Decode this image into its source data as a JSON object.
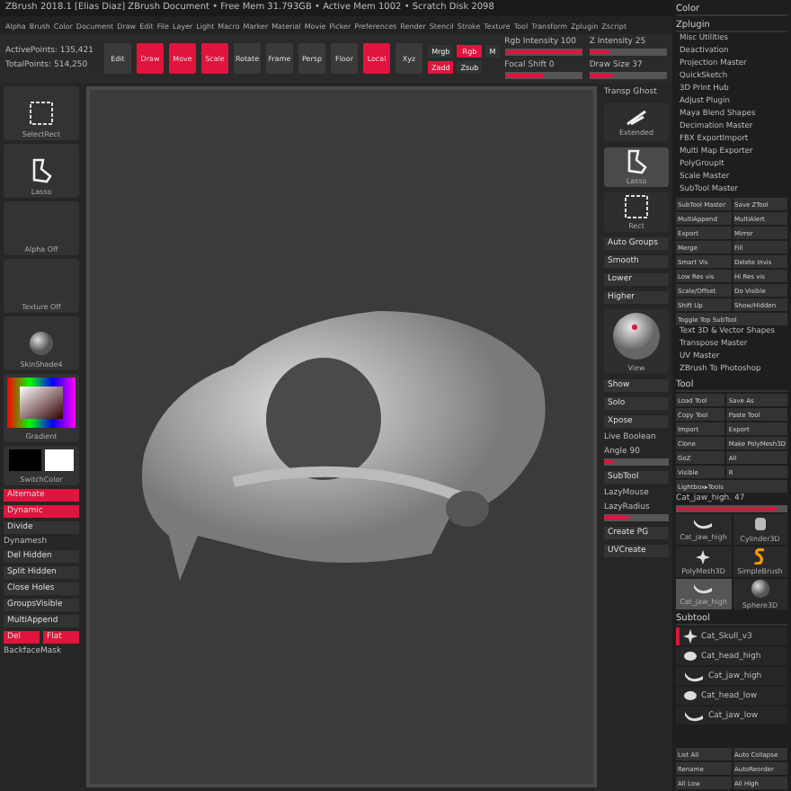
{
  "title": "ZBrush 2018.1 [Elias Diaz] ZBrush Document  • Free Mem 31.793GB • Active Mem 1002 • Scratch Disk 2098",
  "menu": [
    "Alpha",
    "Brush",
    "Color",
    "Document",
    "Draw",
    "Edit",
    "File",
    "Layer",
    "Light",
    "Macro",
    "Marker",
    "Material",
    "Movie",
    "Picker",
    "Preferences",
    "Render",
    "Stencil",
    "Stroke",
    "Texture",
    "Tool",
    "Transform",
    "Zplugin",
    "Zscript"
  ],
  "points": [
    "ActivePoints: 135,421",
    "TotalPoints: 514,250"
  ],
  "toolbar": {
    "buttons": [
      {
        "label": "Edit",
        "selected": false
      },
      {
        "label": "Draw",
        "selected": true
      },
      {
        "label": "Move",
        "selected": true
      },
      {
        "label": "Scale",
        "selected": true
      },
      {
        "label": "Rotate",
        "selected": false
      },
      {
        "label": "Frame",
        "selected": false
      },
      {
        "label": "Persp",
        "selected": false
      },
      {
        "label": "Floor",
        "selected": false
      },
      {
        "label": "Local",
        "selected": true
      },
      {
        "label": "Xyz",
        "selected": false
      }
    ],
    "modes": [
      {
        "label": "Mrgb",
        "selected": false
      },
      {
        "label": "Rgb",
        "selected": true
      },
      {
        "label": "M",
        "selected": false
      },
      {
        "label": "Zadd",
        "selected": true
      },
      {
        "label": "Zsub",
        "selected": false
      }
    ],
    "sliders": [
      {
        "label": "Rgb Intensity 100",
        "level": 1
      },
      {
        "label": "Z Intensity 25",
        "level": 0.25
      },
      {
        "label": "Focal Shift 0",
        "level": 0.5
      },
      {
        "label": "Draw Size 37",
        "level": 0.3
      }
    ]
  },
  "left_shelf": [
    {
      "kind": "tile",
      "label": "SelectRect"
    },
    {
      "kind": "tile",
      "label": "Lasso"
    },
    {
      "kind": "tile",
      "label": "Alpha Off"
    },
    {
      "kind": "tile",
      "label": "Texture Off"
    },
    {
      "kind": "tile",
      "label": "SkinShade4"
    },
    {
      "kind": "picker",
      "label": "Gradient"
    },
    {
      "kind": "swatch",
      "label": "SwitchColor"
    },
    {
      "kind": "button",
      "label": "Alternate",
      "selected": true
    },
    {
      "kind": "button",
      "label": "Dynamic",
      "selected": true
    },
    {
      "kind": "button",
      "label": "Divide",
      "selected": false
    },
    {
      "kind": "label",
      "label": "Dynamesh"
    },
    {
      "kind": "button",
      "label": "Del Hidden",
      "selected": false
    },
    {
      "kind": "button",
      "label": "Split Hidden",
      "selected": false
    },
    {
      "kind": "button",
      "label": "Close Holes",
      "selected": false
    },
    {
      "kind": "button",
      "label": "GroupsVisible",
      "selected": false
    },
    {
      "kind": "button",
      "label": "MultiAppend",
      "selected": false
    },
    {
      "kind": "pair",
      "labels": [
        "Del",
        "Flat"
      ],
      "selected": true
    },
    {
      "kind": "label",
      "label": "BackfaceMask"
    }
  ],
  "right_shelf": [
    {
      "kind": "label",
      "label": "Transp Ghost"
    },
    {
      "kind": "tile",
      "label": "Extended",
      "selected": false
    },
    {
      "kind": "tile",
      "label": "Lasso",
      "selected": true
    },
    {
      "kind": "tile",
      "label": "Rect",
      "selected": false
    },
    {
      "kind": "button",
      "label": "Auto Groups"
    },
    {
      "kind": "button",
      "label": "Smooth"
    },
    {
      "kind": "button",
      "label": "Lower"
    },
    {
      "kind": "button",
      "label": "Higher"
    },
    {
      "kind": "sphere",
      "label": "View"
    },
    {
      "kind": "button",
      "label": "Show"
    },
    {
      "kind": "button",
      "label": "Solo"
    },
    {
      "kind": "button",
      "label": "Xpose"
    },
    {
      "kind": "label",
      "label": "Live Boolean"
    },
    {
      "kind": "slider",
      "label": "Angle 90",
      "level": 0.15
    },
    {
      "kind": "button",
      "label": "SubTool"
    },
    {
      "kind": "label",
      "label": "LazyMouse"
    },
    {
      "kind": "slider",
      "label": "LazyRadius",
      "level": 0.4
    },
    {
      "kind": "button",
      "label": "Create PG"
    },
    {
      "kind": "button",
      "label": "UVCreate"
    }
  ],
  "palette": {
    "headers": [
      "Color",
      "Zplugin"
    ],
    "plugins": [
      "Misc Utilities",
      "Deactivation",
      "Projection Master",
      "QuickSketch",
      "3D Print Hub",
      "Adjust Plugin",
      "Maya Blend Shapes",
      "Decimation Master",
      "FBX ExportImport",
      "Multi Map Exporter",
      "PolyGroupIt",
      "Scale Master",
      "SubTool Master"
    ],
    "subtool_master": [
      "SubTool Master",
      "Save ZTool",
      "MultiAppend",
      "MultiAlert",
      "Export",
      "Mirror",
      "Merge",
      "Fill",
      "Smart Vis",
      "Delete Invis",
      "Low Res vis",
      "Hi Res vis",
      "Scale/Offset",
      "Do Visible",
      "Shift Up",
      "Show/Hidden"
    ],
    "toggle": "Toggle Top SubTool",
    "more_plugins": [
      "Text 3D & Vector Shapes",
      "Transpose Master",
      "UV Master",
      "ZBrush To Photoshop"
    ],
    "tool_header": "Tool",
    "tool_buttons": [
      "Load Tool",
      "Save As",
      "Copy Tool",
      "Paste Tool",
      "Import",
      "Export",
      "Clone",
      "Make PolyMesh3D",
      "GoZ",
      "All",
      "Visible",
      "R"
    ],
    "lightbox": "Lightbox▸Tools",
    "current_tool": {
      "label": "Cat_jaw_high. 47",
      "level": 0.9
    },
    "thumbs": [
      {
        "label": "Cat_jaw_high",
        "selected": false
      },
      {
        "label": "Cylinder3D",
        "selected": false
      },
      {
        "label": "PolyMesh3D",
        "selected": false
      },
      {
        "label": "SimpleBrush",
        "selected": false
      },
      {
        "label": "Cat_jaw_high",
        "selected": true
      },
      {
        "label": "Sphere3D",
        "selected": false
      }
    ],
    "subtool_header": "Subtool",
    "subtools": [
      {
        "name": "Cat_Skull_v3",
        "selected": true
      },
      {
        "name": "Cat_head_high",
        "selected": false
      },
      {
        "name": "Cat_jaw_high",
        "selected": false
      },
      {
        "name": "Cat_head_low",
        "selected": false
      },
      {
        "name": "Cat_jaw_low",
        "selected": false
      }
    ],
    "bottom_buttons": [
      "List All",
      "Auto Collapse",
      "Rename",
      "AutoReorder",
      "All Low",
      "All High"
    ]
  }
}
